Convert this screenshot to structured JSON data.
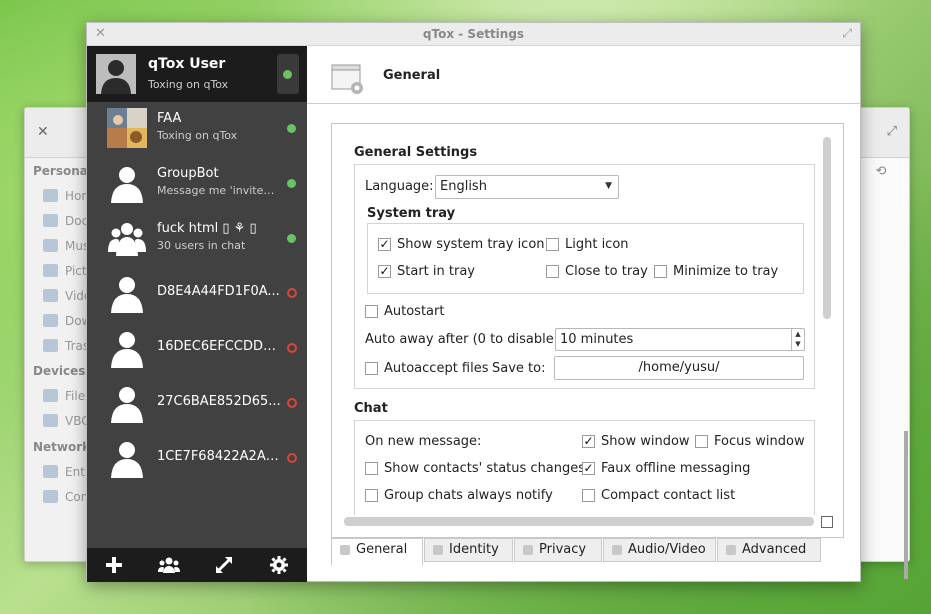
{
  "background_window": {
    "sections": [
      "Personal",
      "Devices",
      "Network"
    ],
    "items": [
      "Home",
      "Documents",
      "Music",
      "Pictures",
      "Videos",
      "Downloads",
      "Trash",
      "File System",
      "VBOX",
      "Entire network",
      "Connect to server"
    ]
  },
  "window": {
    "title": "qTox - Settings"
  },
  "profile": {
    "name": "qTox User",
    "status": "Toxing on qTox",
    "online": true
  },
  "contacts": [
    {
      "name": "FAA",
      "status": "Toxing on qTox",
      "online": true,
      "kind": "photo"
    },
    {
      "name": "GroupBot",
      "status": "Message me 'invite' to get invited",
      "online": true,
      "kind": "user"
    },
    {
      "name": "fuck html  ▯ ⚘ ▯",
      "status": "30 users in chat",
      "online": true,
      "kind": "group"
    },
    {
      "name": "D8E4A44FD1F0A...",
      "status": "",
      "online": false,
      "kind": "user"
    },
    {
      "name": "16DEC6EFCCDD7...",
      "status": "",
      "online": false,
      "kind": "user"
    },
    {
      "name": "27C6BAE852D65...",
      "status": "",
      "online": false,
      "kind": "user"
    },
    {
      "name": "1CE7F68422A2A8...",
      "status": "",
      "online": false,
      "kind": "user"
    }
  ],
  "sidebar_buttons": [
    "add-contact",
    "create-group",
    "transfers",
    "settings"
  ],
  "content": {
    "header": "General",
    "general_settings": {
      "title": "General Settings",
      "language_label": "Language:",
      "language_value": "English",
      "system_tray": {
        "title": "System tray",
        "show_tray_icon": {
          "label": "Show system tray icon",
          "checked": true
        },
        "light_icon": {
          "label": "Light icon",
          "checked": false
        },
        "start_in_tray": {
          "label": "Start in tray",
          "checked": true
        },
        "close_to_tray": {
          "label": "Close to tray",
          "checked": false
        },
        "minimize_to_tray": {
          "label": "Minimize to tray",
          "checked": false
        }
      },
      "autostart": {
        "label": "Autostart",
        "checked": false
      },
      "auto_away_label": "Auto away after (0 to disable):",
      "auto_away_value": "10 minutes",
      "autoaccept": {
        "label": "Autoaccept files",
        "checked": false
      },
      "save_to_label": "Save to:",
      "save_to_path": "/home/yusu/"
    },
    "chat": {
      "title": "Chat",
      "on_new_message_label": "On new message:",
      "show_window": {
        "label": "Show window",
        "checked": true
      },
      "focus_window": {
        "label": "Focus window",
        "checked": false
      },
      "status_changes": {
        "label": "Show contacts' status changes",
        "checked": false
      },
      "faux_offline": {
        "label": "Faux offline messaging",
        "checked": true
      },
      "group_notify": {
        "label": "Group chats always notify",
        "checked": false
      },
      "compact_list": {
        "label": "Compact contact list",
        "checked": false
      }
    },
    "tabs": [
      "General",
      "Identity",
      "Privacy",
      "Audio/Video",
      "Advanced"
    ],
    "active_tab": "General"
  },
  "colors": {
    "online": "#6bc260",
    "offline": "#d9453a",
    "sidebar": "#414141",
    "sidebar_dark": "#1c1c1c"
  }
}
